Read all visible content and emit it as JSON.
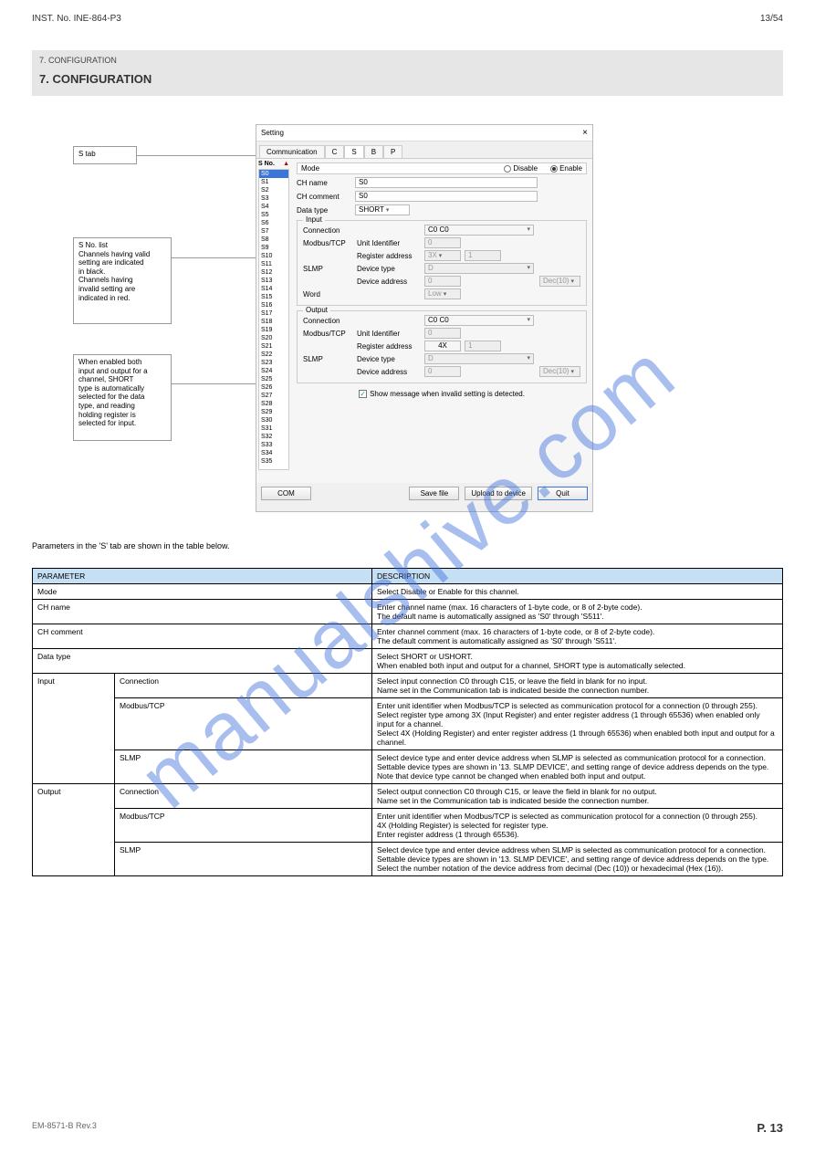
{
  "page_header": {
    "left": "INST. No. INE-864-P3",
    "right": "13/54",
    "section": "7. CONFIGURATION",
    "title": "7. CONFIGURATION"
  },
  "watermark": "manualshive.com",
  "callouts": {
    "c1": "S tab",
    "c2": "S No. list\nChannels having valid\nsetting are indicated\nin black.\nChannels having\ninvalid setting are\nindicated in red.",
    "c3": "When enabled both\ninput and output for a\nchannel, SHORT\ntype is automatically\nselected for the data\ntype, and reading\nholding register is\nselected for input."
  },
  "dialog": {
    "title": "Setting",
    "close": "×",
    "tabs": {
      "t0": "Communication",
      "t1": "C",
      "t2": "S",
      "t3": "B",
      "t4": "P"
    },
    "sno_header": "S No.",
    "sno_caret": "▲",
    "sno_items": [
      "S0",
      "S1",
      "S2",
      "S3",
      "S4",
      "S5",
      "S6",
      "S7",
      "S8",
      "S9",
      "S10",
      "S11",
      "S12",
      "S13",
      "S14",
      "S15",
      "S16",
      "S17",
      "S18",
      "S19",
      "S20",
      "S21",
      "S22",
      "S23",
      "S24",
      "S25",
      "S26",
      "S27",
      "S28",
      "S29",
      "S30",
      "S31",
      "S32",
      "S33",
      "S34",
      "S35"
    ],
    "mode": {
      "label": "Mode",
      "disable": "Disable",
      "enable": "Enable"
    },
    "chname": {
      "label": "CH name",
      "value": "S0"
    },
    "chcomment": {
      "label": "CH comment",
      "value": "S0"
    },
    "datatype": {
      "label": "Data type",
      "value": "SHORT"
    },
    "input": {
      "title": "Input",
      "connection": {
        "label": "Connection",
        "value": "C0  C0"
      },
      "modbus": {
        "label": "Modbus/TCP",
        "unit_label": "Unit Identifier",
        "unit_value": "0",
        "reg_label": "Register address",
        "reg_prefix": "3X",
        "reg_value": "1"
      },
      "slmp": {
        "label": "SLMP",
        "dev_label": "Device type",
        "dev_value": "D",
        "addr_label": "Device address",
        "addr_value": "0",
        "dec": "Dec(10)"
      },
      "word": {
        "label": "Word",
        "value": "Low"
      }
    },
    "output": {
      "title": "Output",
      "connection": {
        "label": "Connection",
        "value": "C0  C0"
      },
      "modbus": {
        "label": "Modbus/TCP",
        "unit_label": "Unit Identifier",
        "unit_value": "0",
        "reg_label": "Register address",
        "reg_prefix": "4X",
        "reg_value": "1"
      },
      "slmp": {
        "label": "SLMP",
        "dev_label": "Device type",
        "dev_value": "D",
        "addr_label": "Device address",
        "addr_value": "0",
        "dec": "Dec(10)"
      }
    },
    "checkbox": "Show message when invalid setting is detected.",
    "footer": {
      "com": "COM",
      "save": "Save file",
      "upload": "Upload to device",
      "quit": "Quit"
    }
  },
  "table_intro": "Parameters in the 'S' tab are shown in the table below.",
  "table": {
    "headers": {
      "h1": "PARAMETER",
      "h2": "DESCRIPTION"
    },
    "rows": {
      "r1_param": "Mode",
      "r1_desc": "Select Disable or Enable for this channel.",
      "r2_param": "CH name",
      "r2_desc": "Enter channel name (max. 16 characters of 1-byte code, or 8 of 2-byte code).\nThe default name is automatically assigned as 'S0' through 'S511'.",
      "r3_param": "CH comment",
      "r3_desc": "Enter channel comment (max. 16 characters of 1-byte code, or 8 of 2-byte code).\nThe default comment is automatically assigned as 'S0' through 'S511'.",
      "r4_param": "Data type",
      "r4_desc": "Select SHORT or USHORT.\nWhen enabled both input and output for a channel, SHORT type is automatically selected.",
      "r5_param": "Input",
      "r5_sub1": "Connection",
      "r5_sub1_desc": "Select input connection C0 through C15, or leave the field in blank for no input.\nName set in the Communication tab is indicated beside the connection number.",
      "r5_sub2": "Modbus/TCP",
      "r5_sub2_desc": "Enter unit identifier when Modbus/TCP is selected as communication protocol for a connection (0 through 255).\nSelect register type among 3X (Input Register) and enter register address (1 through 65536) when enabled only input for a channel.\nSelect 4X (Holding Register) and enter register address (1 through 65536) when enabled both input and output for a channel.",
      "r5_sub3": "SLMP",
      "r5_sub3_desc": "Select device type and enter device address when SLMP is selected as communication protocol for a connection.\nSettable device types are shown in '13. SLMP DEVICE', and setting range of device address depends on the type.\nNote that device type cannot be changed when enabled both input and output.",
      "r6_param": "Output",
      "r6_sub1": "Connection",
      "r6_sub1_desc": "Select output connection C0 through C15, or leave the field in blank for no output.\nName set in the Communication tab is indicated beside the connection number.",
      "r6_sub2": "Modbus/TCP",
      "r6_sub2_desc": "Enter unit identifier when Modbus/TCP is selected as communication protocol for a connection (0 through 255).\n4X (Holding Register) is selected for register type.\nEnter register address (1 through 65536).",
      "r6_sub3": "SLMP",
      "r6_sub3_desc": "Select device type and enter device address when SLMP is selected as communication protocol for a connection.\nSettable device types are shown in '13. SLMP DEVICE', and setting range of device address depends on the type.\nSelect the number notation of the device address from decimal (Dec (10)) or hexadecimal (Hex (16))."
    }
  },
  "footer": {
    "left": "EM-8571-B Rev.3",
    "right": "P. 13"
  }
}
